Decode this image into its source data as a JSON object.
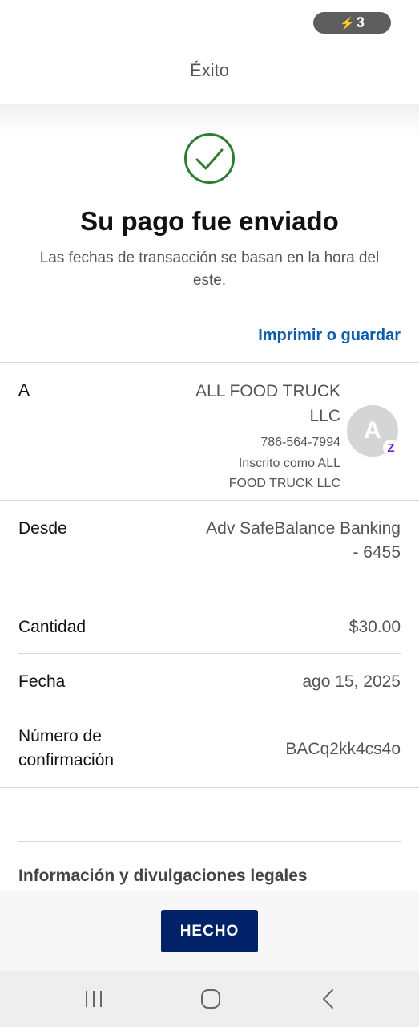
{
  "status": {
    "battery_text": "3"
  },
  "header": {
    "title": "Éxito"
  },
  "success": {
    "title": "Su pago fue enviado",
    "subtitle": "Las fechas de transacción se basan en la hora del este."
  },
  "actions": {
    "print_label": "Imprimir o guardar",
    "done_label": "HECHO"
  },
  "details": {
    "to": {
      "label": "A",
      "name_line1": "ALL FOOD TRUCK",
      "name_line2": "LLC",
      "phone": "786-564-7994",
      "registered_line1": "Inscrito como ALL",
      "registered_line2": "FOOD TRUCK LLC",
      "avatar_initial": "A",
      "badge_glyph": "Z"
    },
    "from": {
      "label": "Desde",
      "value_line1": "Adv SafeBalance Banking",
      "value_line2": "- 6455"
    },
    "amount": {
      "label": "Cantidad",
      "value": "$30.00"
    },
    "date": {
      "label": "Fecha",
      "value": "ago 15, 2025"
    },
    "confirmation": {
      "label_line1": "Número de",
      "label_line2": "confirmación",
      "value": "BACq2kk4cs4o"
    }
  },
  "legal": {
    "title": "Información y divulgaciones legales"
  },
  "colors": {
    "brand_blue": "#012169",
    "link_blue": "#0b5cab",
    "success_green": "#2e7d32",
    "zelle_purple": "#6d1ed4"
  },
  "icons": {
    "success": "checkmark-circle-icon",
    "status": "bolt-icon",
    "nav": [
      "recent-apps-icon",
      "home-icon",
      "back-icon"
    ]
  }
}
